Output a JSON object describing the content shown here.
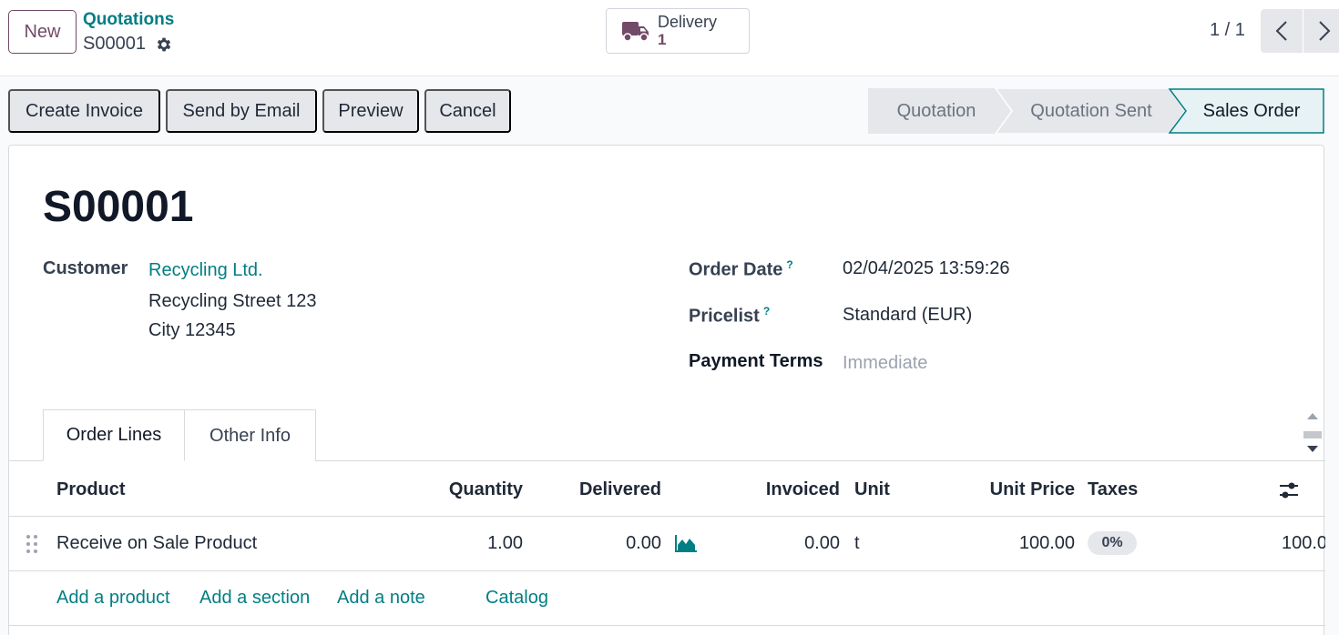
{
  "control_panel": {
    "new_label": "New",
    "breadcrumb": "Quotations",
    "record_name": "S00001",
    "smart_button": {
      "label": "Delivery",
      "value": "1",
      "icon": "truck-icon"
    },
    "pager": "1 / 1"
  },
  "actions": {
    "create_invoice": "Create Invoice",
    "send_email": "Send by Email",
    "preview": "Preview",
    "cancel": "Cancel"
  },
  "status": {
    "stages": [
      "Quotation",
      "Quotation Sent",
      "Sales Order"
    ],
    "current": "Sales Order",
    "accent": "#017e84"
  },
  "form": {
    "title": "S00001",
    "customer_label": "Customer",
    "customer_name": "Recycling Ltd.",
    "customer_street": "Recycling Street 123",
    "customer_city": "City 12345",
    "order_date_label": "Order Date",
    "order_date": "02/04/2025 13:59:26",
    "pricelist_label": "Pricelist",
    "pricelist": "Standard (EUR)",
    "payment_terms_label": "Payment Terms",
    "payment_terms_placeholder": "Immediate",
    "help_mark": "?"
  },
  "tabs": [
    "Order Lines",
    "Other Info"
  ],
  "table": {
    "columns": [
      "Product",
      "Quantity",
      "Delivered",
      "Invoiced",
      "Unit",
      "Unit Price",
      "Taxes"
    ],
    "row": {
      "product": "Receive on Sale Product",
      "quantity": "1.00",
      "delivered": "0.00",
      "invoiced": "0.00",
      "unit": "t",
      "unit_price": "100.00",
      "taxes": "0%",
      "subtotal": "100.0"
    },
    "add_links": [
      "Add a product",
      "Add a section",
      "Add a note",
      "Catalog"
    ]
  },
  "colors": {
    "brand": "#714b67",
    "link": "#017e84"
  }
}
